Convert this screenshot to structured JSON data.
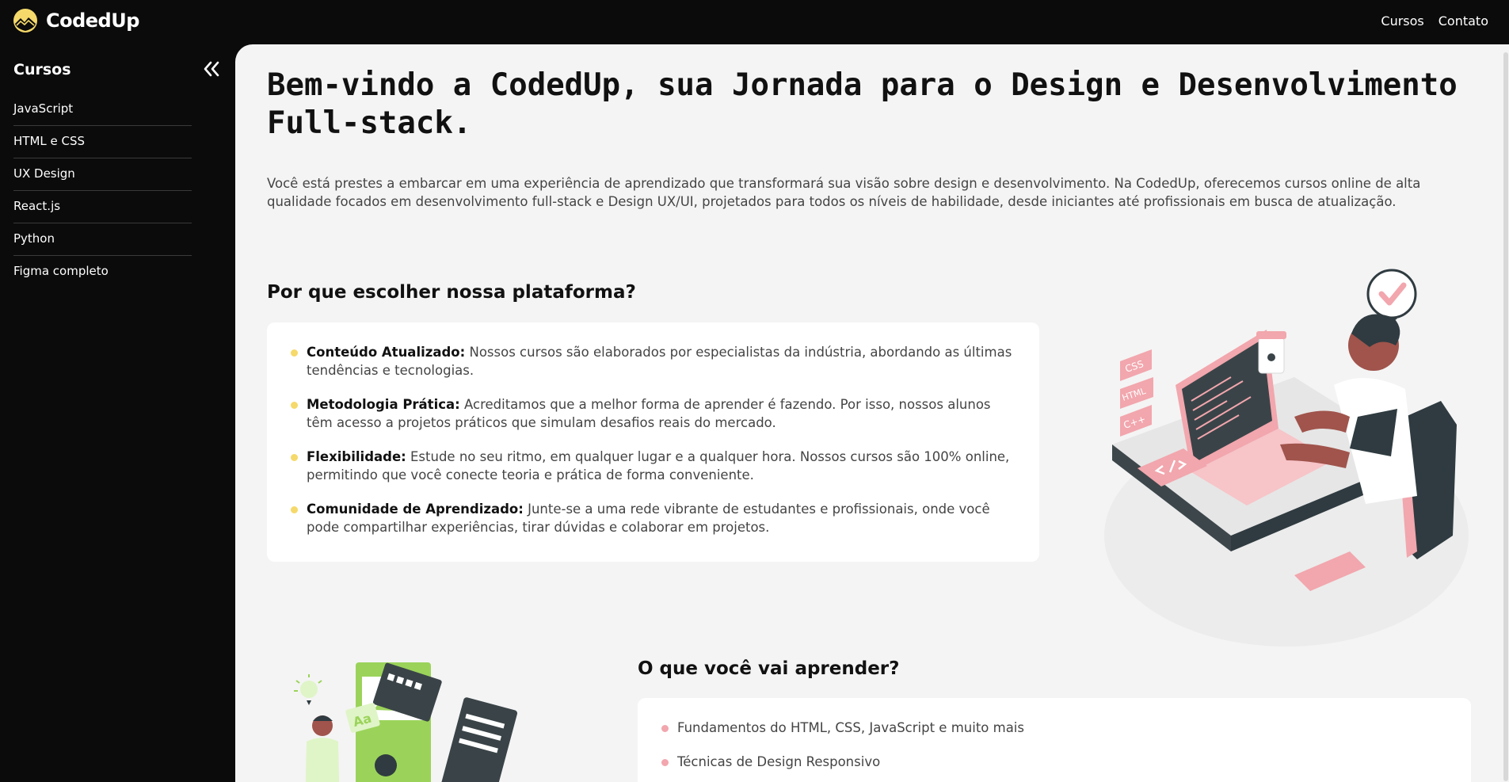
{
  "brand": {
    "name": "CodedUp",
    "logo_icon": "sun-mountain-icon",
    "accent": "#f5d96a",
    "accent_pink": "#f2a6ad"
  },
  "topnav": {
    "items": [
      {
        "label": "Cursos"
      },
      {
        "label": "Contato"
      }
    ]
  },
  "sidebar": {
    "title": "Cursos",
    "collapse_icon": "double-chevron-left-icon",
    "items": [
      {
        "label": "JavaScript"
      },
      {
        "label": "HTML e CSS"
      },
      {
        "label": "UX Design"
      },
      {
        "label": "React.js"
      },
      {
        "label": "Python"
      },
      {
        "label": "Figma completo"
      }
    ]
  },
  "hero": {
    "title": "Bem-vindo a CodedUp, sua Jornada para o Design e Desenvolvimento Full-stack.",
    "intro": "Você está prestes a embarcar em uma experiência de aprendizado que transformará sua visão sobre design e desenvolvimento. Na CodedUp, oferecemos cursos online de alta qualidade focados em desenvolvimento full-stack e Design UX/UI, projetados para todos os níveis de habilidade, desde iniciantes até profissionais em busca de atualização."
  },
  "why": {
    "heading": "Por que escolher nossa plataforma?",
    "items": [
      {
        "title": "Conteúdo Atualizado:",
        "text": " Nossos cursos são elaborados por especialistas da indústria, abordando as últimas tendências e tecnologias."
      },
      {
        "title": "Metodologia Prática:",
        "text": " Acreditamos que a melhor forma de aprender é fazendo. Por isso, nossos alunos têm acesso a projetos práticos que simulam desafios reais do mercado."
      },
      {
        "title": "Flexibilidade:",
        "text": " Estude no seu ritmo, em qualquer lugar e a qualquer hora. Nossos cursos são 100% online, permitindo que você conecte teoria e prática de forma conveniente."
      },
      {
        "title": "Comunidade de Aprendizado:",
        "text": " Junte-se a uma rede vibrante de estudantes e profissionais, onde você pode compartilhar experiências, tirar dúvidas e colaborar em projetos."
      }
    ],
    "illustration": {
      "icon": "developer-at-desk-illustration",
      "tags": [
        "CSS",
        "HTML",
        "C++"
      ]
    }
  },
  "learn": {
    "heading": "O que você vai aprender?",
    "items": [
      {
        "text": "Fundamentos do HTML, CSS, JavaScript e muito mais"
      },
      {
        "text": "Técnicas de Design Responsivo"
      }
    ],
    "illustration": {
      "icon": "web-design-team-illustration",
      "tag": "Aa"
    }
  }
}
